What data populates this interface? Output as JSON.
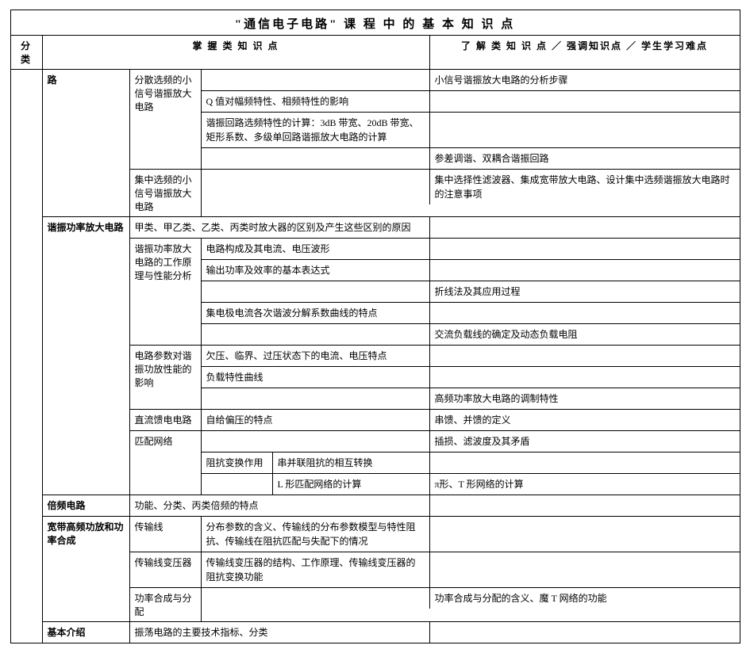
{
  "title": "\"通信电子电路\" 课 程 中 的 基 本 知 识 点",
  "header": {
    "category": "分类",
    "master": "掌 握 类 知 识 点",
    "understand": "了 解 类 知 识 点 ／ 强调知识点 ／ 学生学习难点"
  },
  "sec1": {
    "label": "路",
    "sub1_label": "分散选频的小信号谐振放大电路",
    "sub1_r1_u": "小信号谐振放大电路的分析步骤",
    "sub1_r2_m": "Q 值对幅频特性、相频特性的影响",
    "sub1_r3_m": "谐振回路选频特性的计算：3dB 带宽、20dB 带宽、矩形系数、多级单回路谐振放大电路的计算",
    "sub1_r4_u": "参差调谐、双耦合谐振回路",
    "sub2_label": "集中选频的小信号谐振放大电路",
    "sub2_r1_u": "集中选择性滤波器、集成宽带放大电路、设计集中选频谐振放大电路时的注意事项"
  },
  "sec2": {
    "label": "谐振功率放大电路",
    "r0_m": "甲类、甲乙类、乙类、丙类时放大器的区别及产生这些区别的原因",
    "sub1_label": "谐振功率放大电路的工作原理与性能分析",
    "sub1_r1_m": "电路构成及其电流、电压波形",
    "sub1_r2_m": "输出功率及效率的基本表达式",
    "sub1_r3_u": "折线法及其应用过程",
    "sub1_r4_m": "集电极电流各次谐波分解系数曲线的特点",
    "sub1_r5_u": "交流负载线的确定及动态负载电阻",
    "sub2_label": "电路参数对谐振功放性能的影响",
    "sub2_r1_m": "欠压、临界、过压状态下的电流、电压特点",
    "sub2_r2_m": "负载特性曲线",
    "sub2_r3_u": "高频功率放大电路的调制特性",
    "sub3_label": "直流馈电电路",
    "sub3_r1_m": "自给偏压的特点",
    "sub3_r1_u": "串馈、并馈的定义",
    "sub4_label": "匹配网络",
    "sub4_r1_u": "插损、滤波度及其矛盾",
    "sub4_r2_m_left": "阻抗变换作用",
    "sub4_r2_m_right": "串并联阻抗的相互转换",
    "sub4_r3_m_right": "L 形匹配网络的计算",
    "sub4_r3_u": "π形、T 形网络的计算"
  },
  "sec3": {
    "label": "倍频电路",
    "r1_m": "功能、分类、丙类倍频的特点"
  },
  "sec4": {
    "label": "宽带高频功放和功率合成",
    "sub1_label": "传输线",
    "sub1_r1_m": "分布参数的含义、传输线的分布参数模型与特性阻抗、传输线在阻抗匹配与失配下的情况",
    "sub2_label": "传输线变压器",
    "sub2_r1_m": "传输线变压器的结构、工作原理、传输线变压器的阻抗变换功能",
    "sub3_label": "功率合成与分配",
    "sub3_r1_u": "功率合成与分配的含义、魔 T 网络的功能"
  },
  "sec5": {
    "label": "基本介绍",
    "r1_m": "振荡电路的主要技术指标、分类"
  }
}
